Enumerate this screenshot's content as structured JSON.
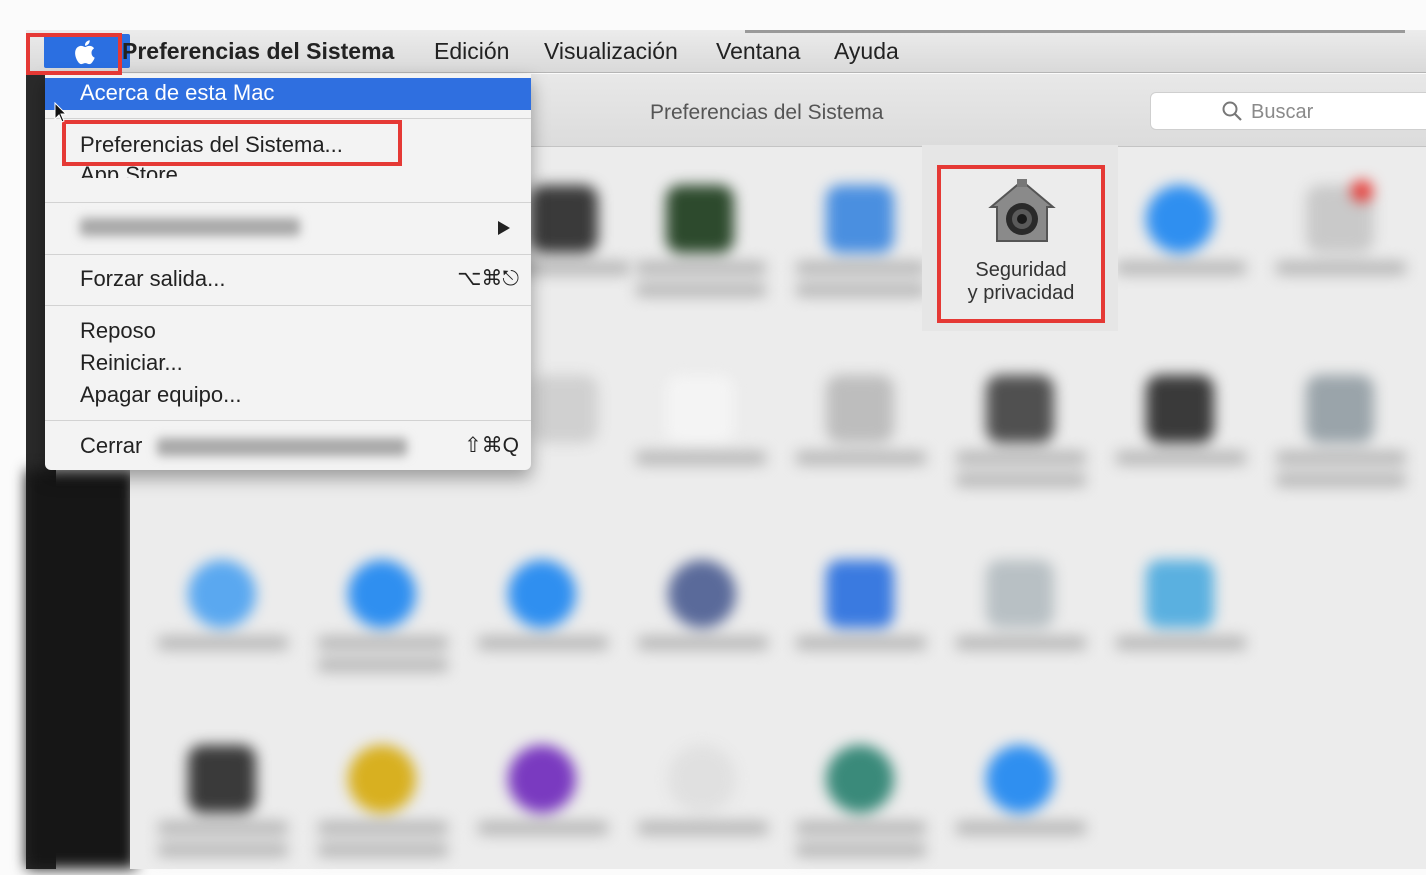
{
  "menubar": {
    "app_name": "Preferencias del Sistema",
    "items": [
      "Edición",
      "Visualización",
      "Ventana",
      "Ayuda"
    ]
  },
  "apple_menu": {
    "about": "Acerca de esta Mac",
    "system_prefs": "Preferencias del Sistema...",
    "app_store": "App Store",
    "force_quit": "Forzar salida...",
    "force_quit_shortcut": "⌥⌘⎋",
    "sleep": "Reposo",
    "restart": "Reiniciar...",
    "shutdown": "Apagar equipo...",
    "logout": "Cerrar",
    "logout_shortcut": "⇧⌘Q"
  },
  "window": {
    "title": "Preferencias del Sistema",
    "search_placeholder": "Buscar"
  },
  "security_pane": {
    "label_line1": "Seguridad",
    "label_line2": "y privacidad"
  },
  "colors": {
    "highlight": "#e53935",
    "menu_selection": "#2f6fe0"
  }
}
